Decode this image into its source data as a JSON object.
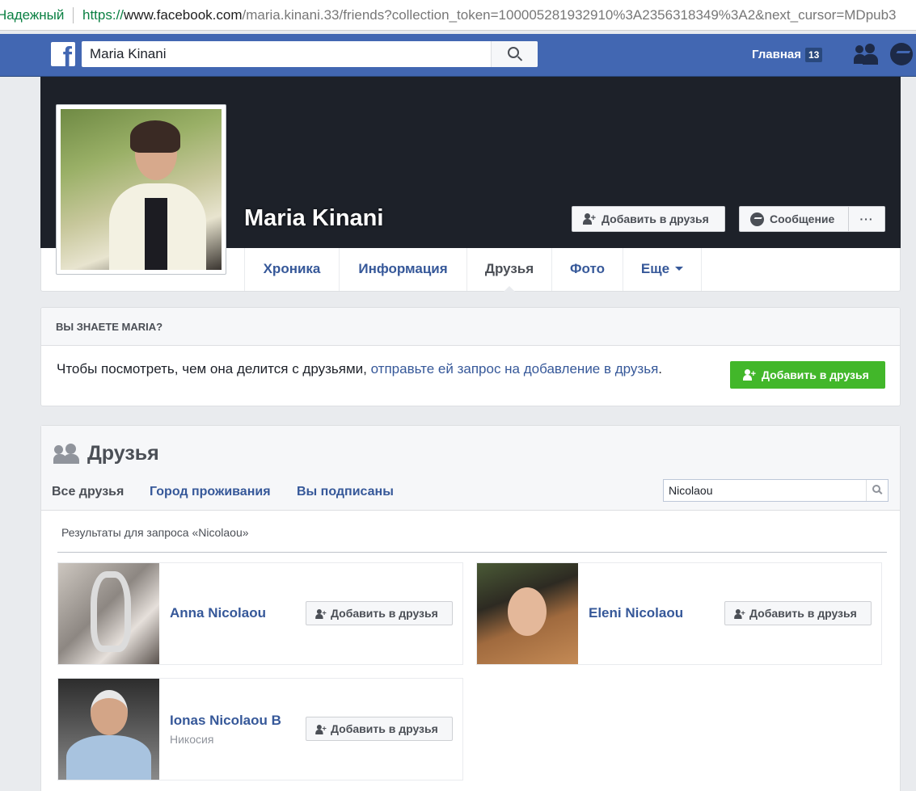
{
  "browser": {
    "secure_label": "Надежный",
    "url_scheme": "https://",
    "url_domain": "www.facebook.com",
    "url_path": "/maria.kinani.33/friends?collection_token=100005281932910%3A2356318349%3A2&next_cursor=MDpub3"
  },
  "topbar": {
    "search_value": "Maria Kinani",
    "home_label": "Главная",
    "home_count": "13",
    "icons": [
      "facebook-logo",
      "search-icon",
      "friend-requests-icon",
      "messenger-icon"
    ]
  },
  "profile": {
    "name": "Maria Kinani",
    "add_friend_label": "Добавить в друзья",
    "message_label": "Сообщение",
    "more_label": "···"
  },
  "nav": {
    "tabs": [
      {
        "label": "Хроника"
      },
      {
        "label": "Информация"
      },
      {
        "label": "Друзья"
      },
      {
        "label": "Фото"
      },
      {
        "label": "Еще"
      }
    ],
    "active": "Друзья"
  },
  "know": {
    "heading": "ВЫ ЗНАЕТЕ MARIA?",
    "text": "Чтобы посмотреть, чем она делится с друзьями, ",
    "link": "отправьте ей запрос на добавление в друзья",
    "text_end": ".",
    "button_label": "Добавить в друзья"
  },
  "friends": {
    "title": "Друзья",
    "tabs": [
      {
        "label": "Все друзья"
      },
      {
        "label": "Город проживания"
      },
      {
        "label": "Вы подписаны"
      }
    ],
    "search_value": "Nicolaou",
    "results_label": "Результаты для запроса «Nicolaou»",
    "results": [
      {
        "name": "Anna Nicolaou",
        "subtitle": "",
        "button": "Добавить в друзья"
      },
      {
        "name": "Eleni Nicolaou",
        "subtitle": "",
        "button": "Добавить в друзья"
      },
      {
        "name": "Ionas Nicolaou B",
        "subtitle": "Никосия",
        "button": "Добавить в друзья"
      }
    ]
  },
  "colors": {
    "fb_blue": "#4267b2",
    "link_blue": "#365899",
    "green": "#42b72a",
    "cover": "#1d2129"
  }
}
